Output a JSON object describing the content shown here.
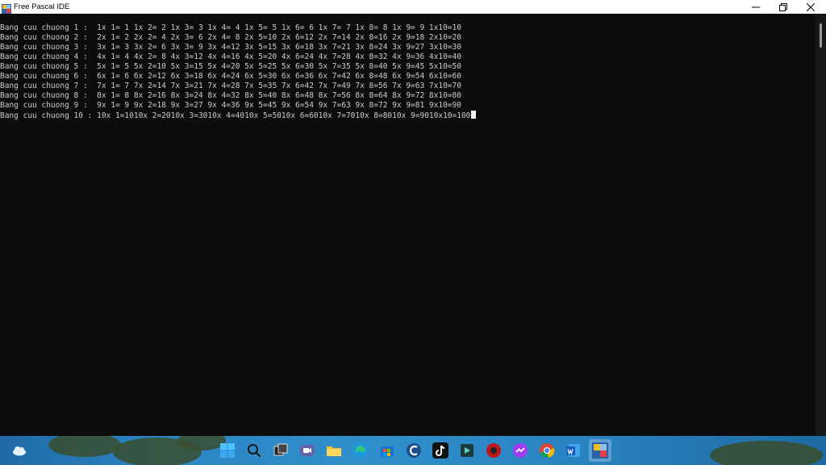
{
  "window": {
    "title": "Free Pascal IDE",
    "icons": {
      "app": "free-pascal-app-icon",
      "minimize": "minimize-icon",
      "restore": "restore-icon",
      "close": "close-icon"
    }
  },
  "console": {
    "lines": [
      "Bang cuu chuong 1 :  1x 1= 1 1x 2= 2 1x 3= 3 1x 4= 4 1x 5= 5 1x 6= 6 1x 7= 7 1x 8= 8 1x 9= 9 1x10=10",
      "Bang cuu chuong 2 :  2x 1= 2 2x 2= 4 2x 3= 6 2x 4= 8 2x 5=10 2x 6=12 2x 7=14 2x 8=16 2x 9=18 2x10=20",
      "Bang cuu chuong 3 :  3x 1= 3 3x 2= 6 3x 3= 9 3x 4=12 3x 5=15 3x 6=18 3x 7=21 3x 8=24 3x 9=27 3x10=30",
      "Bang cuu chuong 4 :  4x 1= 4 4x 2= 8 4x 3=12 4x 4=16 4x 5=20 4x 6=24 4x 7=28 4x 8=32 4x 9=36 4x10=40",
      "Bang cuu chuong 5 :  5x 1= 5 5x 2=10 5x 3=15 5x 4=20 5x 5=25 5x 6=30 5x 7=35 5x 8=40 5x 9=45 5x10=50",
      "Bang cuu chuong 6 :  6x 1= 6 6x 2=12 6x 3=18 6x 4=24 6x 5=30 6x 6=36 6x 7=42 6x 8=48 6x 9=54 6x10=60",
      "Bang cuu chuong 7 :  7x 1= 7 7x 2=14 7x 3=21 7x 4=28 7x 5=35 7x 6=42 7x 7=49 7x 8=56 7x 9=63 7x10=70",
      "Bang cuu chuong 8 :  8x 1= 8 8x 2=16 8x 3=24 8x 4=32 8x 5=40 8x 6=48 8x 7=56 8x 8=64 8x 9=72 8x10=80",
      "Bang cuu chuong 9 :  9x 1= 9 9x 2=18 9x 3=27 9x 4=36 9x 5=45 9x 6=54 9x 7=63 9x 8=72 9x 9=81 9x10=90",
      "Bang cuu chuong 10 : 10x 1=1010x 2=2010x 3=3010x 4=4010x 5=5010x 6=6010x 7=7010x 8=8010x 9=9010x10=100"
    ],
    "text_color": "#cccccc",
    "background": "#0c0c0c"
  },
  "taskbar": {
    "icons": [
      "weather-icon",
      "start-windows-icon",
      "search-icon",
      "task-view-icon",
      "teams-video-icon",
      "file-explorer-icon",
      "edge-browser-icon",
      "microsoft-store-icon",
      "ccleaner-icon",
      "tiktok-icon",
      "media-app-icon",
      "red-circle-app-icon",
      "messenger-icon",
      "chrome-icon",
      "word-icon",
      "free-pascal-taskbar-icon"
    ]
  }
}
